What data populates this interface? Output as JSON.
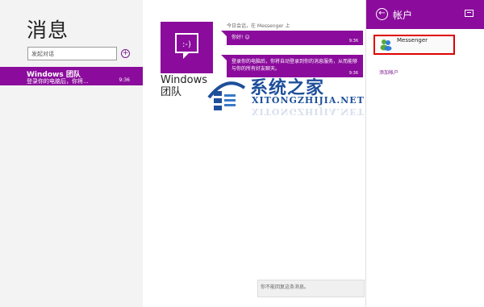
{
  "left": {
    "title": "消息",
    "search_placeholder": "发起对话",
    "new_conversation_glyph": "+",
    "conversation": {
      "name": "Windows 团队",
      "preview": "登录你的电脑后，你将...",
      "time": "9:36"
    }
  },
  "chat": {
    "contact_name": "Windows 团队",
    "avatar_glyph": ":-)",
    "meta": "今日会话，在 Messenger 上",
    "messages": [
      {
        "text": "你好! ☺",
        "time": "9:36"
      },
      {
        "text": "登录你的电脑后，你将自动登录到你的消息服务，从而能够与你的所有好友聊天。",
        "time": "9:36"
      }
    ],
    "input_placeholder": "你不能回复这条消息。"
  },
  "watermark": {
    "cn": "系统之家",
    "en": "XITONGZHIJIA.NET"
  },
  "flyout": {
    "title": "帐户",
    "back_glyph": "←",
    "account_label": "Messenger",
    "add_account": "添加帐户"
  },
  "colors": {
    "accent": "#8b0c9c",
    "highlight": "#e00000"
  }
}
